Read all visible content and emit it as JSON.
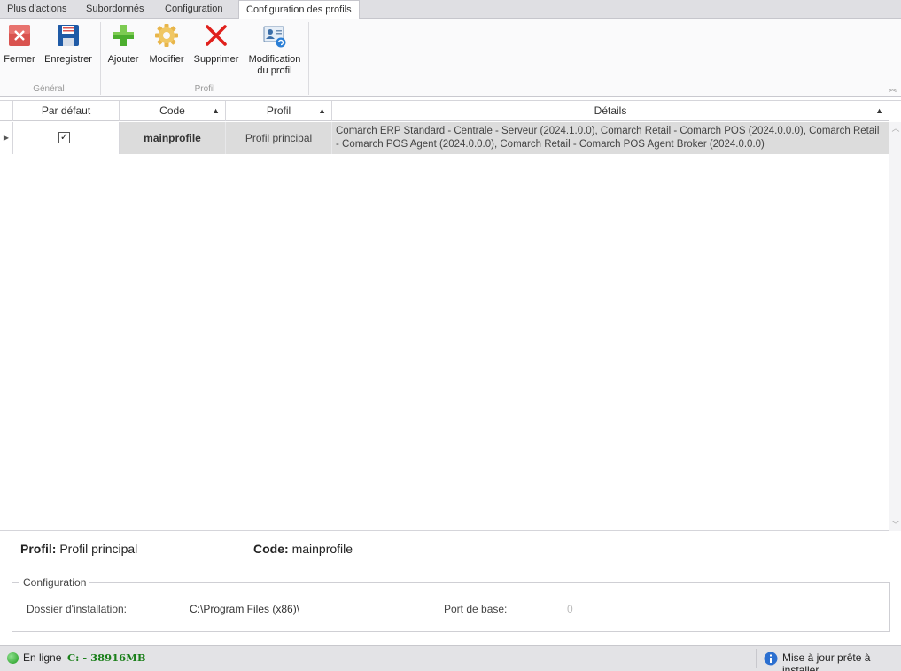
{
  "tabs": [
    {
      "label": "Plus d'actions",
      "active": false
    },
    {
      "label": "Subordonnés",
      "active": false
    },
    {
      "label": "Configuration",
      "active": false
    },
    {
      "label": "Configuration des profils",
      "active": true
    }
  ],
  "ribbon": {
    "groups": {
      "general": "Général",
      "profil": "Profil"
    },
    "buttons": {
      "fermer": "Fermer",
      "enregistrer": "Enregistrer",
      "ajouter": "Ajouter",
      "modifier": "Modifier",
      "supprimer": "Supprimer",
      "modification_line1": "Modification",
      "modification_line2": "du profil"
    },
    "icons": [
      "close-icon",
      "save-icon",
      "add-icon",
      "gear-icon",
      "delete-icon",
      "profile-edit-icon"
    ]
  },
  "grid": {
    "columns": {
      "default": "Par défaut",
      "code": "Code",
      "profil": "Profil",
      "details": "Détails"
    },
    "rows": [
      {
        "default": true,
        "code": "mainprofile",
        "profil": "Profil principal",
        "details_line1": "Comarch ERP Standard - Centrale - Serveur (2024.1.0.0), Comarch Retail - Comarch POS (2024.0.0.0), Comarch Retail",
        "details_line2": "- Comarch POS Agent (2024.0.0.0), Comarch Retail - Comarch POS Agent Broker (2024.0.0.0)"
      }
    ]
  },
  "detail": {
    "profil_label": "Profil:",
    "profil_value": "Profil principal",
    "code_label": "Code:",
    "code_value": "mainprofile",
    "config_legend": "Configuration",
    "install_label": "Dossier d'installation:",
    "install_value": "C:\\Program Files (x86)\\",
    "port_label": "Port de base:",
    "port_value": "0"
  },
  "status": {
    "online": "En ligne",
    "disk": "C: - 38916MB",
    "update": "Mise à jour prête à installer"
  },
  "colors": {
    "selected_row": "#dcdcdc",
    "disk_text": "#1a7f1a",
    "online_dot": "#1e9a1e"
  }
}
